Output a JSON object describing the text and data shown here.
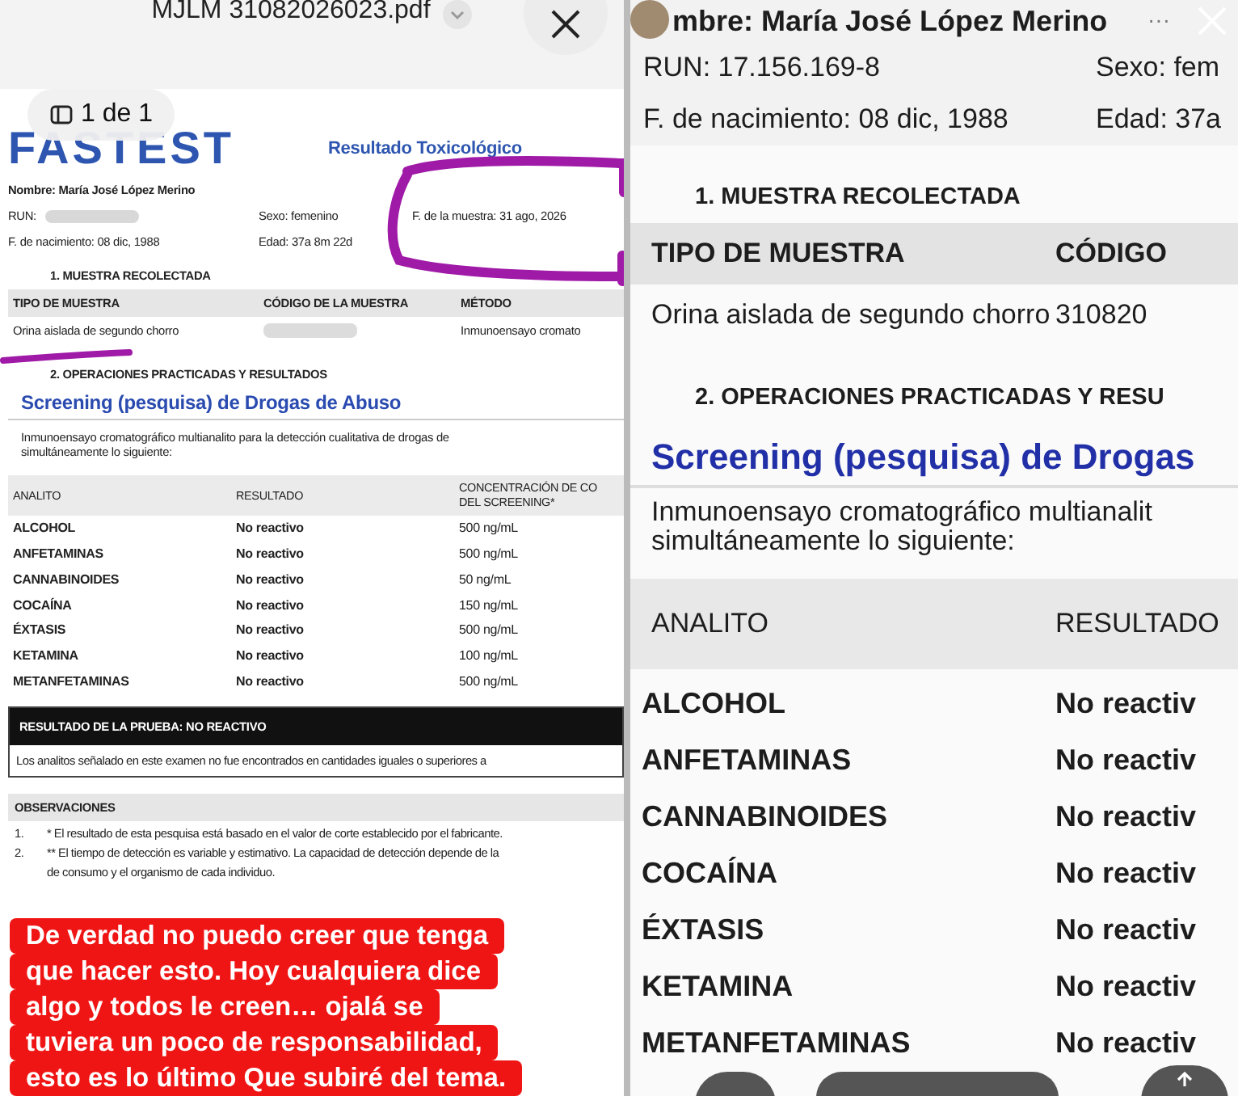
{
  "viewer": {
    "file_name": "MJLM 31082026023.pdf",
    "page_indicator": "1 de 1"
  },
  "document": {
    "logo": "FASTEST",
    "title": "Resultado Toxicológico",
    "patient": [
      {
        "label": "Nombre: María José López Merino",
        "redacted": false
      },
      {
        "label": "RUN:",
        "redacted": true
      },
      {
        "label": "Sexo: femenino",
        "redacted": false
      },
      {
        "label": "F. de la muestra: 31 ago, 2026",
        "redacted": false
      },
      {
        "label": "F. de nacimiento: 08 dic, 1988",
        "redacted": false
      },
      {
        "label": "Edad: 37a 8m 22d",
        "redacted": false
      }
    ],
    "section_1": "1. MUESTRA RECOLECTADA",
    "sample_columns": [
      "TIPO DE MUESTRA",
      "CÓDIGO DE LA MUESTRA",
      "MÉTODO"
    ],
    "sample_row": [
      {
        "text": "Orina aislada de segundo chorro",
        "redacted": false
      },
      {
        "redacted": true
      },
      {
        "text": "Inmunoensayo cromato",
        "redacted": false
      }
    ],
    "section_2": "2. OPERACIONES PRACTICADAS Y RESULTADOS",
    "heading": "Screening (pesquisa) de Drogas de Abuso",
    "paragraph": [
      "Inmunoensayo cromatográfico multianalito para la detección cualitativa de drogas de",
      "simultáneamente lo siguiente:"
    ],
    "analyte_columns": [
      "ANALITO",
      "RESULTADO",
      "CONCENTRACIÓN DE CO\nDEL SCREENING*"
    ],
    "analytes": [
      [
        "ALCOHOL",
        "No reactivo",
        "500 ng/mL"
      ],
      [
        "ANFETAMINAS",
        "No reactivo",
        "500 ng/mL"
      ],
      [
        "CANNABINOIDES",
        "No reactivo",
        "50 ng/mL"
      ],
      [
        "COCAÍNA",
        "No reactivo",
        "150 ng/mL"
      ],
      [
        "ÉXTASIS",
        "No reactivo",
        "500 ng/mL"
      ],
      [
        "KETAMINA",
        "No reactivo",
        "100 ng/mL"
      ],
      [
        "METANFETAMINAS",
        "No reactivo",
        "500 ng/mL"
      ]
    ],
    "result_title": "RESULTADO DE LA PRUEBA: NO REACTIVO",
    "result_text": "Los analitos señalado en este examen no fue encontrados en cantidades iguales o superiores a",
    "observations_title": "OBSERVACIONES",
    "observations": [
      {
        "number": "1.",
        "text": "* El resultado de esta pesquisa está basado en el valor de corte establecido por el fabricante."
      },
      {
        "number": "2.",
        "text": "** El tiempo de detección es variable y estimativo. La capacidad de detección depende de la"
      },
      {
        "text": "de consumo y el organismo de cada individuo."
      }
    ]
  },
  "caption": [
    "De verdad no puedo creer que tenga",
    "que hacer esto. Hoy cualquiera dice",
    "algo y todos le creen… ojalá se",
    "tuviera un poco de responsabilidad,",
    "esto es lo último Que subiré del tema."
  ],
  "zoom_view": {
    "more_button": "···",
    "info": [
      {
        "left": "mbre: María José López Merino"
      },
      {
        "left": "RUN: 17.156.169-8",
        "right": "Sexo: fem"
      },
      {
        "left": "F. de nacimiento: 08 dic, 1988",
        "right": "Edad: 37a"
      }
    ],
    "section_1": "1. MUESTRA RECOLECTADA",
    "sample_columns": [
      "TIPO DE MUESTRA",
      "CÓDIGO"
    ],
    "sample_row": [
      "Orina aislada de segundo chorro",
      "310820"
    ],
    "section_2": "2. OPERACIONES PRACTICADAS Y RESU",
    "heading": "Screening (pesquisa) de Drogas",
    "paragraph": [
      "Inmunoensayo cromatográfico multianalit",
      "simultáneamente lo siguiente:"
    ],
    "analyte_columns": [
      "ANALITO",
      "RESULTADO"
    ],
    "analytes": [
      [
        "ALCOHOL",
        "No reactiv"
      ],
      [
        "ANFETAMINAS",
        "No reactiv"
      ],
      [
        "CANNABINOIDES",
        "No reactiv"
      ],
      [
        "COCAÍNA",
        "No reactiv"
      ],
      [
        "ÉXTASIS",
        "No reactiv"
      ],
      [
        "KETAMINA",
        "No reactiv"
      ],
      [
        "METANFETAMINAS",
        "No reactiv"
      ]
    ]
  }
}
